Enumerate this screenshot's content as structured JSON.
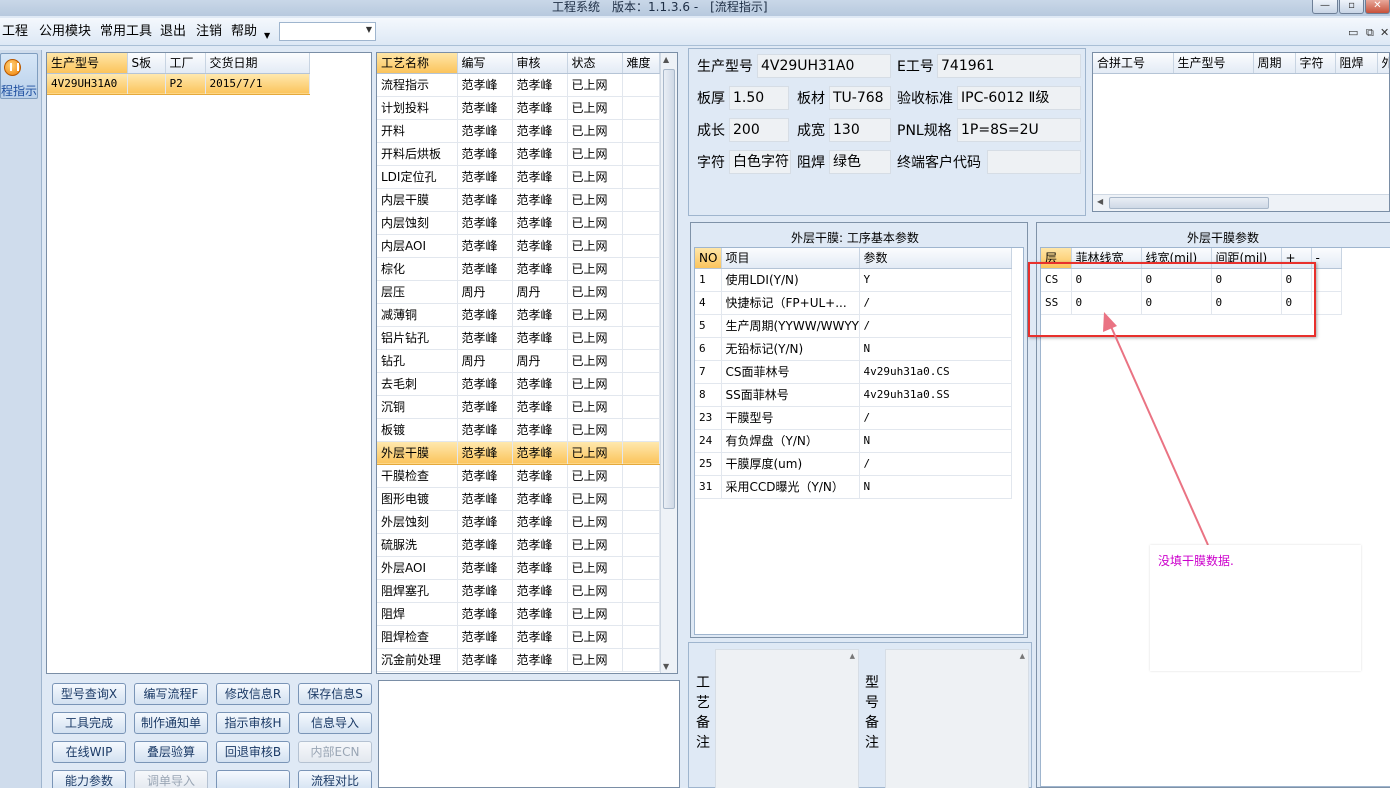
{
  "window": {
    "app_name": "工程系统",
    "version": "版本：1.1.3.6 -",
    "mdi_title": "[流程指示]"
  },
  "menu": [
    "工程",
    "公用模块",
    "常用工具",
    "退出",
    "注销",
    "帮助"
  ],
  "nav": {
    "active_label": "程指示"
  },
  "orders": {
    "columns": [
      "生产型号",
      "S板",
      "工厂",
      "交货日期"
    ],
    "rows": [
      {
        "model": "4V29UH31A0",
        "s": "",
        "factory": "P2",
        "date": "2015/7/1"
      }
    ]
  },
  "processes": {
    "columns": [
      "工艺名称",
      "编写",
      "审核",
      "状态",
      "难度"
    ],
    "rows": [
      [
        "流程指示",
        "范孝峰",
        "范孝峰",
        "已上网",
        ""
      ],
      [
        "计划投料",
        "范孝峰",
        "范孝峰",
        "已上网",
        ""
      ],
      [
        "开料",
        "范孝峰",
        "范孝峰",
        "已上网",
        ""
      ],
      [
        "开料后烘板",
        "范孝峰",
        "范孝峰",
        "已上网",
        ""
      ],
      [
        "LDI定位孔",
        "范孝峰",
        "范孝峰",
        "已上网",
        ""
      ],
      [
        "内层干膜",
        "范孝峰",
        "范孝峰",
        "已上网",
        ""
      ],
      [
        "内层蚀刻",
        "范孝峰",
        "范孝峰",
        "已上网",
        ""
      ],
      [
        "内层AOI",
        "范孝峰",
        "范孝峰",
        "已上网",
        ""
      ],
      [
        "棕化",
        "范孝峰",
        "范孝峰",
        "已上网",
        ""
      ],
      [
        "层压",
        "周丹",
        "周丹",
        "已上网",
        ""
      ],
      [
        "减薄铜",
        "范孝峰",
        "范孝峰",
        "已上网",
        ""
      ],
      [
        "铝片钻孔",
        "范孝峰",
        "范孝峰",
        "已上网",
        ""
      ],
      [
        "钻孔",
        "周丹",
        "周丹",
        "已上网",
        ""
      ],
      [
        "去毛刺",
        "范孝峰",
        "范孝峰",
        "已上网",
        ""
      ],
      [
        "沉铜",
        "范孝峰",
        "范孝峰",
        "已上网",
        ""
      ],
      [
        "板镀",
        "范孝峰",
        "范孝峰",
        "已上网",
        ""
      ],
      [
        "外层干膜",
        "范孝峰",
        "范孝峰",
        "已上网",
        ""
      ],
      [
        "干膜检查",
        "范孝峰",
        "范孝峰",
        "已上网",
        ""
      ],
      [
        "图形电镀",
        "范孝峰",
        "范孝峰",
        "已上网",
        ""
      ],
      [
        "外层蚀刻",
        "范孝峰",
        "范孝峰",
        "已上网",
        ""
      ],
      [
        "硫脲洗",
        "范孝峰",
        "范孝峰",
        "已上网",
        ""
      ],
      [
        "外层AOI",
        "范孝峰",
        "范孝峰",
        "已上网",
        ""
      ],
      [
        "阻焊塞孔",
        "范孝峰",
        "范孝峰",
        "已上网",
        ""
      ],
      [
        "阻焊",
        "范孝峰",
        "范孝峰",
        "已上网",
        ""
      ],
      [
        "阻焊检查",
        "范孝峰",
        "范孝峰",
        "已上网",
        ""
      ],
      [
        "沉金前处理",
        "范孝峰",
        "范孝峰",
        "已上网",
        ""
      ]
    ],
    "selected_index": 16
  },
  "buttons": [
    {
      "label": "型号查询X",
      "disabled": false
    },
    {
      "label": "编写流程F",
      "disabled": false
    },
    {
      "label": "修改信息R",
      "disabled": false
    },
    {
      "label": "保存信息S",
      "disabled": false
    },
    {
      "label": "工具完成",
      "disabled": false
    },
    {
      "label": "制作通知单",
      "disabled": false
    },
    {
      "label": "指示审核H",
      "disabled": false
    },
    {
      "label": "信息导入",
      "disabled": false
    },
    {
      "label": "在线WIP",
      "disabled": false
    },
    {
      "label": "叠层验算",
      "disabled": false
    },
    {
      "label": "回退审核B",
      "disabled": false
    },
    {
      "label": "内部ECN",
      "disabled": true
    },
    {
      "label": "能力参数",
      "disabled": false
    },
    {
      "label": "调单导入",
      "disabled": true
    },
    {
      "label": "",
      "disabled": false
    },
    {
      "label": "流程对比",
      "disabled": false
    }
  ],
  "info": {
    "model_label": "生产型号",
    "model": "4V29UH31A0",
    "e_label": "E工号",
    "e_no": "741961",
    "thick_label": "板厚",
    "thick": "1.50",
    "material_label": "板材",
    "material": "TU-768",
    "standard_label": "验收标准",
    "standard": "IPC-6012 Ⅱ级",
    "length_label": "成长",
    "length": "200",
    "width_label": "成宽",
    "width": "130",
    "pnl_label": "PNL规格",
    "pnl": "1P=8S=2U",
    "char_label": "字符",
    "char": "白色字符",
    "mask_label": "阻焊",
    "mask": "绿色",
    "customer_label": "终端客户代码",
    "customer": ""
  },
  "combo_grid": {
    "columns": [
      "合拼工号",
      "生产型号",
      "周期",
      "字符",
      "阻焊",
      "外"
    ]
  },
  "basic_params": {
    "title": "外层干膜: 工序基本参数",
    "columns": [
      "NO",
      "项目",
      "参数"
    ],
    "rows": [
      [
        "1",
        "使用LDI(Y/N)",
        "Y"
      ],
      [
        "4",
        "快捷标记（FP+UL+...",
        "/"
      ],
      [
        "5",
        "生产周期(YYWW/WWYY)",
        "/"
      ],
      [
        "6",
        "无铅标记(Y/N)",
        "N"
      ],
      [
        "7",
        "CS面菲林号",
        "4v29uh31a0.CS"
      ],
      [
        "8",
        "SS面菲林号",
        "4v29uh31a0.SS"
      ],
      [
        "23",
        "干膜型号",
        "/"
      ],
      [
        "24",
        "有负焊盘（Y/N）",
        "N"
      ],
      [
        "25",
        "干膜厚度(um)",
        "/"
      ],
      [
        "31",
        "采用CCD曝光（Y/N）",
        "N"
      ]
    ]
  },
  "film_params": {
    "title": "外层干膜参数",
    "columns": [
      "层",
      "菲林线宽",
      "线宽(mil)",
      "间距(mil)",
      "+",
      "-"
    ],
    "rows": [
      [
        "CS",
        "0",
        "0",
        "0",
        "0",
        ""
      ],
      [
        "SS",
        "0",
        "0",
        "0",
        "0",
        ""
      ]
    ]
  },
  "notes": {
    "process_label": "工艺备注",
    "model_label": "型号备注"
  },
  "annotation": {
    "text": "没填干膜数据.",
    "color": "#cc00cc",
    "box_color": "#e8302c"
  }
}
